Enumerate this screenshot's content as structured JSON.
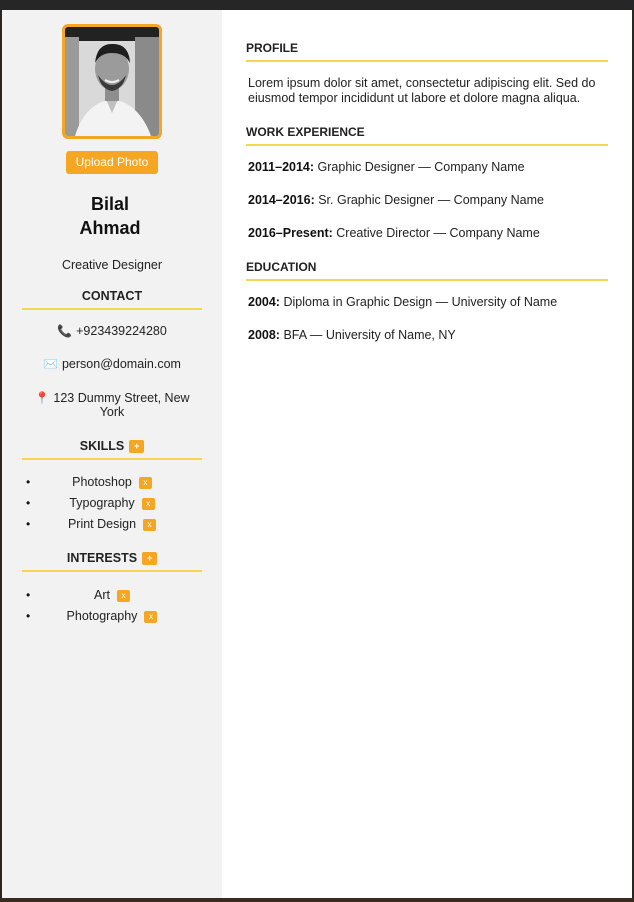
{
  "sidebar": {
    "upload_label": "Upload Photo",
    "first_name": "Bilal",
    "last_name": "Ahmad",
    "role": "Creative Designer",
    "contact": {
      "heading": "CONTACT",
      "phone": "+923439224280",
      "email": "person@domain.com",
      "address_line1": "123 Dummy Street, New",
      "address_line2": "York"
    },
    "skills": {
      "heading": "SKILLS",
      "add_label": "+",
      "items": [
        {
          "label": "Photoshop",
          "remove": "x"
        },
        {
          "label": "Typography",
          "remove": "x"
        },
        {
          "label": "Print Design",
          "remove": "x"
        }
      ]
    },
    "interests": {
      "heading": "INTERESTS",
      "add_label": "+",
      "items": [
        {
          "label": "Art",
          "remove": "x"
        },
        {
          "label": "Photography",
          "remove": "x"
        }
      ]
    },
    "bullet": "•"
  },
  "main": {
    "profile": {
      "heading": "PROFILE",
      "text": "Lorem ipsum dolor sit amet, consectetur adipiscing elit. Sed do eiusmod tempor incididunt ut labore et dolore magna aliqua."
    },
    "work": {
      "heading": "WORK EXPERIENCE",
      "items": [
        {
          "period": "2011–2014:",
          "detail": "Graphic Designer — Company Name"
        },
        {
          "period": "2014–2016:",
          "detail": "Sr. Graphic Designer — Company Name"
        },
        {
          "period": "2016–Present:",
          "detail": "Creative Director — Company Name"
        }
      ]
    },
    "education": {
      "heading": "EDUCATION",
      "items": [
        {
          "year": "2004:",
          "detail": "Diploma in Graphic Design — University of Name"
        },
        {
          "year": "2008:",
          "detail": "BFA — University of Name, NY"
        }
      ]
    }
  },
  "icons": {
    "phone": "📞",
    "email": "✉️",
    "address": "📍"
  },
  "colors": {
    "accent": "#f5a623",
    "divider": "#f5d651",
    "sidebar_bg": "#f2f2f2"
  }
}
